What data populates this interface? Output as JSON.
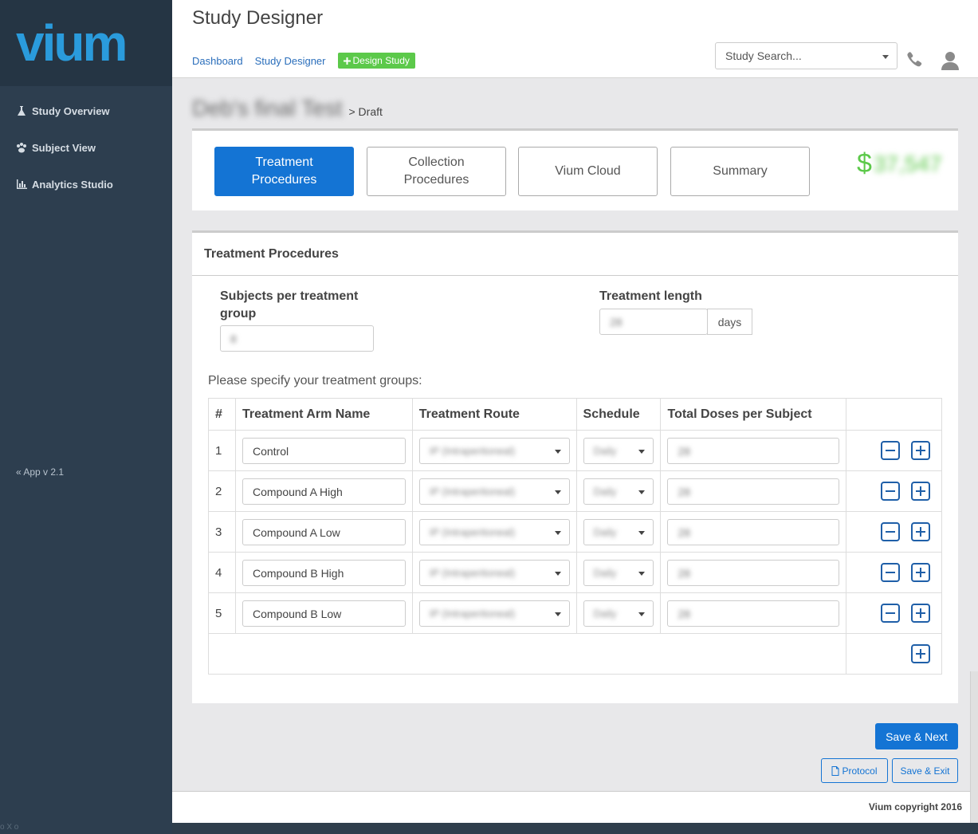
{
  "sidebar": {
    "logo": "vium",
    "items": [
      {
        "label": "Study Overview",
        "icon": "flask-icon"
      },
      {
        "label": "Subject View",
        "icon": "paw-icon"
      },
      {
        "label": "Analytics Studio",
        "icon": "bar-chart-icon"
      }
    ],
    "app_version": "App v 2.1",
    "corner_text": "o X o"
  },
  "header": {
    "title": "Study Designer",
    "breadcrumbs": [
      "Dashboard",
      "Study Designer"
    ],
    "design_button": "Design Study",
    "search_placeholder": "Study Search..."
  },
  "study": {
    "name": "Deb's final Test",
    "status": "> Draft"
  },
  "tabs": [
    "Treatment\nProcedures",
    "Collection\nProcedures",
    "Vium Cloud",
    "Summary"
  ],
  "cost": {
    "symbol": "$",
    "amount": "37,547"
  },
  "treatment": {
    "heading": "Treatment Procedures",
    "subjects_label": "Subjects per treatment group",
    "subjects_value": "8",
    "length_label": "Treatment length",
    "length_value": "28",
    "length_unit": "days",
    "specify_text": "Please specify your treatment groups:",
    "columns": [
      "#",
      "Treatment Arm Name",
      "Treatment Route",
      "Schedule",
      "Total Doses per Subject"
    ],
    "rows": [
      {
        "num": "1",
        "name": "Control",
        "route": "IP (Intraperitoneal)",
        "schedule": "Daily",
        "doses": "28"
      },
      {
        "num": "2",
        "name": "Compound A High",
        "route": "IP (Intraperitoneal)",
        "schedule": "Daily",
        "doses": "28"
      },
      {
        "num": "3",
        "name": "Compound A Low",
        "route": "IP (Intraperitoneal)",
        "schedule": "Daily",
        "doses": "28"
      },
      {
        "num": "4",
        "name": "Compound B High",
        "route": "IP (Intraperitoneal)",
        "schedule": "Daily",
        "doses": "28"
      },
      {
        "num": "5",
        "name": "Compound B Low",
        "route": "IP (Intraperitoneal)",
        "schedule": "Daily",
        "doses": "28"
      }
    ]
  },
  "actions": {
    "save_next": "Save & Next",
    "protocol": "Protocol",
    "save_exit": "Save & Exit"
  },
  "footer": {
    "copyright": "Vium copyright 2016"
  },
  "colors": {
    "accent": "#1474d4",
    "green": "#5cc94a",
    "sidebar": "#2d3e4f",
    "icon_blue": "#1f5fa8"
  }
}
